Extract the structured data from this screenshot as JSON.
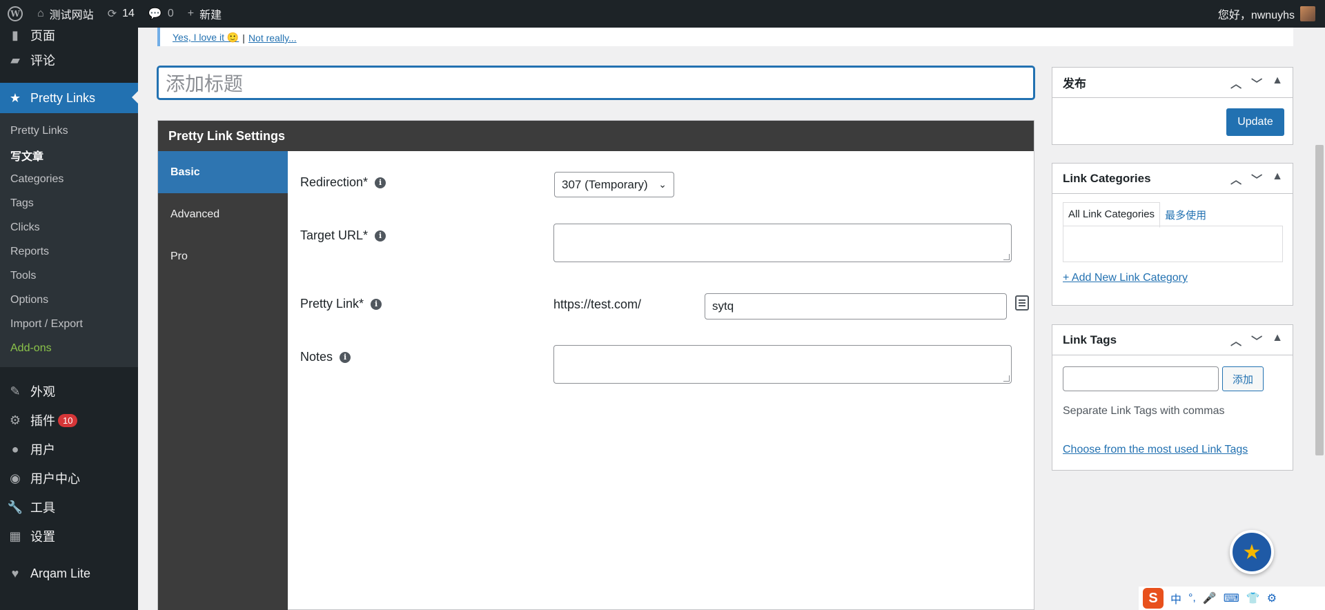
{
  "adminbar": {
    "site_name": "测试网站",
    "updates_count": "14",
    "comments_count": "0",
    "new_label": "新建",
    "greeting": "您好，nwnuyhs"
  },
  "sidebar": {
    "top_items": [
      {
        "label": "页面",
        "icon": "page-icon"
      },
      {
        "label": "评论",
        "icon": "comment-icon"
      }
    ],
    "current_menu": {
      "label": "Pretty Links",
      "icon": "pretty-links-icon"
    },
    "submenu": [
      {
        "label": "Pretty Links"
      },
      {
        "label": "写文章"
      },
      {
        "label": "Categories"
      },
      {
        "label": "Tags"
      },
      {
        "label": "Clicks"
      },
      {
        "label": "Reports"
      },
      {
        "label": "Tools"
      },
      {
        "label": "Options"
      },
      {
        "label": "Import / Export"
      },
      {
        "label": "Add-ons"
      }
    ],
    "bottom_items": [
      {
        "label": "外观",
        "icon": "brush-icon"
      },
      {
        "label": "插件",
        "icon": "plugin-icon",
        "badge": "10"
      },
      {
        "label": "用户",
        "icon": "user-icon"
      },
      {
        "label": "用户中心",
        "icon": "user-center-icon"
      },
      {
        "label": "工具",
        "icon": "wrench-icon"
      },
      {
        "label": "设置",
        "icon": "settings-icon"
      },
      {
        "label": "Arqam Lite",
        "icon": "heart-icon"
      }
    ]
  },
  "notice": {
    "yes_link": "Yes, I love it 🙂",
    "separator": "|",
    "no_link": "Not really..."
  },
  "title_input": {
    "placeholder": "添加标题"
  },
  "settings": {
    "header": "Pretty Link Settings",
    "tabs": [
      "Basic",
      "Advanced",
      "Pro"
    ],
    "fields": {
      "redirection_label": "Redirection*",
      "redirection_value": "307 (Temporary)",
      "target_url_label": "Target URL*",
      "target_url_value": "",
      "pretty_link_label": "Pretty Link*",
      "pretty_link_prefix": "https://test.com/",
      "pretty_link_slug": "sytq",
      "notes_label": "Notes",
      "notes_value": ""
    }
  },
  "publish_box": {
    "title": "发布",
    "update_button": "Update"
  },
  "categories_box": {
    "title": "Link Categories",
    "tab_all": "All Link Categories",
    "tab_most_used": "最多使用",
    "add_link": "+ Add New Link Category"
  },
  "tags_box": {
    "title": "Link Tags",
    "add_button": "添加",
    "hint": "Separate Link Tags with commas",
    "choose_link": "Choose from the most used Link Tags"
  },
  "ime": {
    "mode": "中"
  },
  "colors": {
    "admin_bar": "#1d2327",
    "accent": "#2271b1",
    "settings_dark": "#3c3c3c",
    "addons_green": "#8bc34a",
    "badge_red": "#d63638"
  }
}
